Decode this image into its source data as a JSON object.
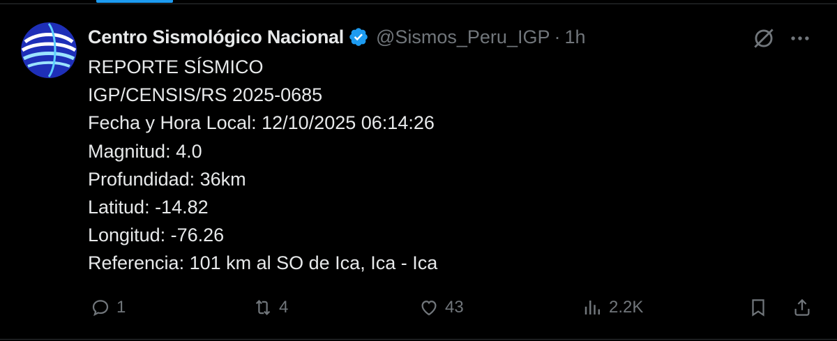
{
  "tweet": {
    "display_name": "Centro Sismológico Nacional",
    "handle": "@Sismos_Peru_IGP",
    "separator": "·",
    "time": "1h",
    "lines": [
      "REPORTE SÍSMICO",
      "IGP/CENSIS/RS 2025-0685",
      "Fecha y Hora Local: 12/10/2025 06:14:26",
      "Magnitud: 4.0",
      "Profundidad: 36km",
      "Latitud: -14.82",
      "Longitud: -76.26",
      "Referencia: 101 km al SO de Ica, Ica - Ica"
    ]
  },
  "actions": {
    "replies": "1",
    "reposts": "4",
    "likes": "43",
    "views": "2.2K"
  },
  "icons": {
    "avatar": "seismograph-logo",
    "verified": "verified-badge-icon",
    "grok": "grok-icon",
    "more": "more-icon",
    "reply": "reply-icon",
    "repost": "repost-icon",
    "like": "heart-icon",
    "views": "analytics-icon",
    "bookmark": "bookmark-icon",
    "share": "share-icon"
  },
  "colors": {
    "background": "#000000",
    "text": "#e7e9ea",
    "secondary": "#71767b",
    "accent": "#1d9bf0"
  }
}
